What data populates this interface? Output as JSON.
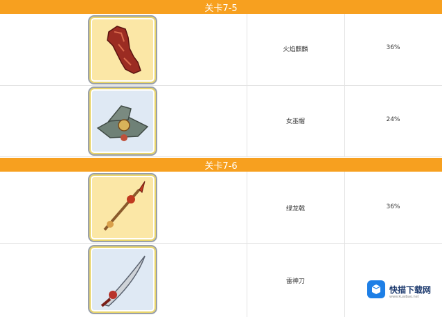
{
  "sections": [
    {
      "title": "关卡7-5",
      "items": [
        {
          "name": "火焰麒麟",
          "rate": "36%",
          "icon": "flame-gauntlet-icon",
          "bg": "#fbe7a6"
        },
        {
          "name": "女巫帽",
          "rate": "24%",
          "icon": "witch-hat-icon",
          "bg": "#dfe9f4"
        }
      ]
    },
    {
      "title": "关卡7-6",
      "items": [
        {
          "name": "绿龙戟",
          "rate": "36%",
          "icon": "spear-icon",
          "bg": "#fbe7a6"
        },
        {
          "name": "雷神刀",
          "rate": "",
          "icon": "saber-icon",
          "bg": "#dfe9f4"
        }
      ]
    }
  ],
  "watermark": {
    "text": "快描下载网",
    "url": "www.kuaibao.net"
  },
  "colors": {
    "header_bg": "#f7a01f",
    "header_text": "#ffffff",
    "grid": "#e3e3e3"
  }
}
